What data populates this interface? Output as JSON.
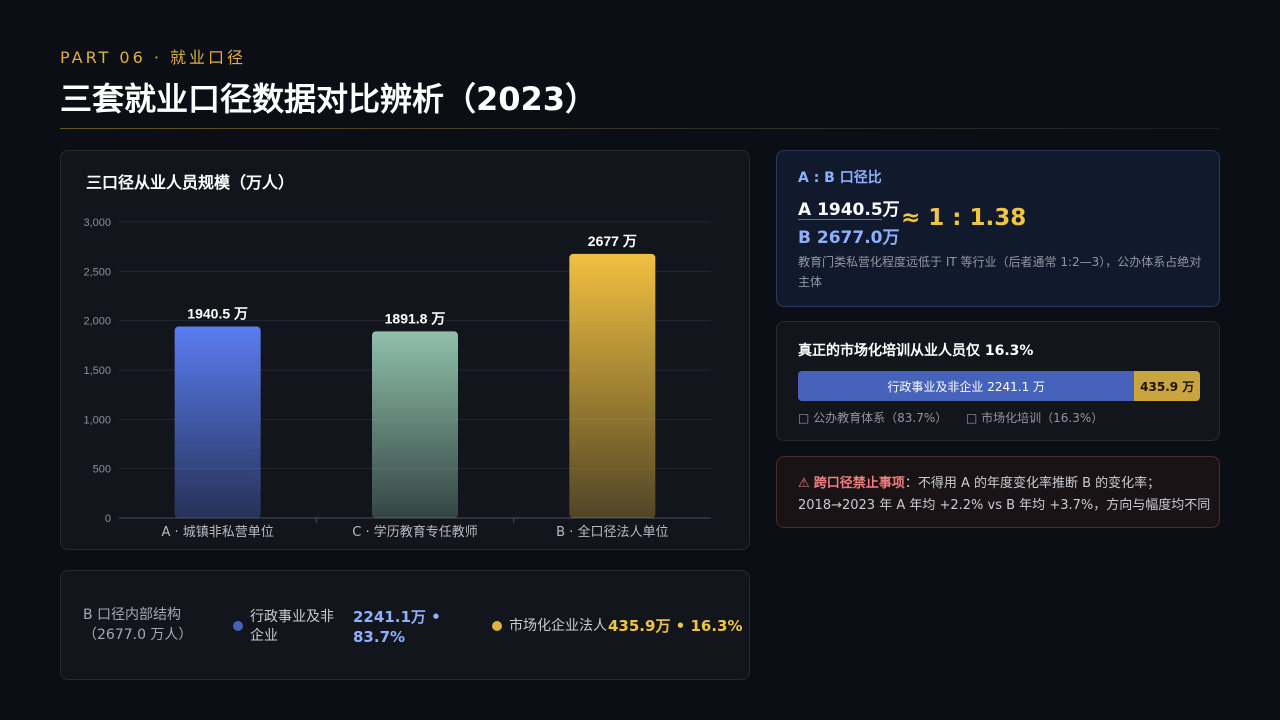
{
  "header": {
    "part_label": "PART 06 · 就业口径",
    "title": "三套就业口径数据对比辨析（2023）"
  },
  "chart_data": {
    "type": "bar",
    "title": "三口径从业人员规模（万人）",
    "categories": [
      "A · 城镇非私营单位",
      "C · 学历教育专任教师",
      "B · 全口径法人单位"
    ],
    "values": [
      1940.5,
      1891.8,
      2677
    ],
    "data_labels": [
      "1940.5 万",
      "1891.8 万",
      "2677 万"
    ],
    "yticks": [
      "0",
      "500",
      "1,000",
      "1,500",
      "2,000",
      "2,500",
      "3,000"
    ],
    "ylim": [
      0,
      3000
    ],
    "colors": [
      "#5a7cf0",
      "#8fc0aa",
      "#f0c040"
    ],
    "grid": true
  },
  "structure": {
    "label": "B 口径内部结构（2677.0 万人）",
    "items": [
      {
        "name": "行政事业及非企业",
        "value": "2241.1万 • 83.7%",
        "color": "#4662bb",
        "value_color": "#8fb0ff"
      },
      {
        "name": "市场化企业法人",
        "value": "435.9万 • 16.3%",
        "color": "#e0b13e",
        "value_color": "#f2c443"
      }
    ]
  },
  "ratio": {
    "heading": "A : B 口径比",
    "a": "A 1940.5万",
    "b": "B 2677.0万",
    "value": "≈ 1 : 1.38",
    "note": "教育门类私营化程度远低于 IT 等行业（后者通常 1:2—3），公办体系占绝对主体"
  },
  "market": {
    "heading": "真正的市场化培训从业人员仅 16.3%",
    "seg_a_label": "行政事业及非企业 2241.1 万",
    "seg_b_label": "435.9 万",
    "seg_a_fraction": 0.837,
    "legend_a": "□ 公办教育体系（83.7%）",
    "legend_b": "□ 市场化培训（16.3%）"
  },
  "warning": {
    "icon": "⚠",
    "title": "跨口径禁止事项",
    "line1_rest": "：不得用 A 的年度变化率推断 B 的变化率；",
    "line2": "2018→2023 年 A 年均 +2.2% vs B 年均 +3.7%，方向与幅度均不同"
  }
}
